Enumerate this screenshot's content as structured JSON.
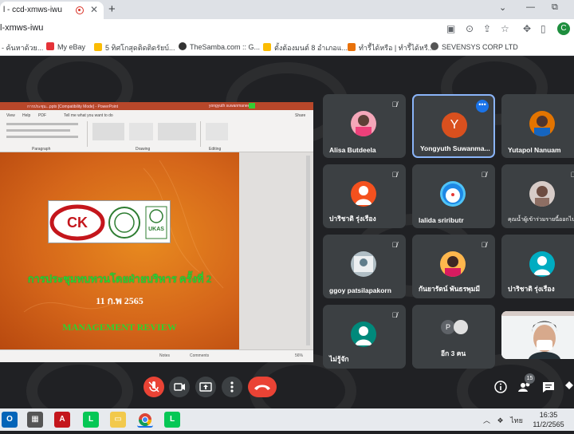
{
  "browser": {
    "tab_title": "l - ccd-xmws-iwu",
    "tab_close": "✕",
    "new_tab": "+",
    "url": "l-xmws-iwu",
    "profile_initial": "C",
    "window_min": "—",
    "window_restore": "⧉"
  },
  "bookmarks": [
    {
      "label": "- ค้นหาด้วย...",
      "color": "#4285f4"
    },
    {
      "label": "My eBay",
      "color": "#e53238"
    },
    {
      "label": "5 ทิศโกสุดติดติดรัยบ์...",
      "color": "#fbbc04"
    },
    {
      "label": "TheSamba.com :: G...",
      "color": "#333333"
    },
    {
      "label": "ตั้งต้องมนต์ 8 อำเภอแ...",
      "color": "#fbbc04"
    },
    {
      "label": "ทำรี้ได้หรือ | ทำรี้ได้หรื...",
      "color": "#e8710a"
    },
    {
      "label": "SEVENSYS CORP LTD",
      "color": "#555555"
    }
  ],
  "presentation": {
    "window_title": "การประชุม...pptx [Compatibility Mode] - PowerPoint",
    "user": "yongyuth suwanmanee",
    "ribbon_tabs": [
      "View",
      "Help",
      "PDF",
      "Tell me what you want to do",
      "Share"
    ],
    "ribbon_groups": [
      "Paragraph",
      "Drawing",
      "Editing"
    ],
    "slide_title": "การประชุมทบทวนโดยฝ่ายบริหาร ครั้งที่ 2",
    "slide_date": "11 ก.พ 2565",
    "slide_subtitle": "MANAGEMENT REVIEW",
    "logo_text": "CK",
    "cert_label": "UKAS",
    "status_notes": "Notes",
    "status_comments": "Comments",
    "zoom": "56%"
  },
  "participants": [
    {
      "name": "Alisa Butdeela",
      "avatar": "photo",
      "color": "#f4a7b9",
      "muted": true
    },
    {
      "name": "Yongyuth Suwanma...",
      "avatar": "Y",
      "color": "#d9501e",
      "muted": false,
      "active": true
    },
    {
      "name": "Yutapol Nanuam",
      "avatar": "photo",
      "color": "#e37400",
      "muted": false
    },
    {
      "name": "ปาริชาติ รุ่งเรือง",
      "avatar": "person",
      "color": "#f4511e",
      "muted": true
    },
    {
      "name": "lalida sriributr",
      "avatar": "photo",
      "color": "#4fc3f7",
      "muted": true
    },
    {
      "name": "คุณน้ำผู้เข้าร่วมรายนี้ออกไป",
      "avatar": "photo",
      "color": "#d7ccc8",
      "muted": true
    },
    {
      "name": "ggoy patsilapakorn",
      "avatar": "photo",
      "color": "#b0bec5",
      "muted": true
    },
    {
      "name": "กันยารัตน์ พันธรพุมมี",
      "avatar": "photo",
      "color": "#ffb74d",
      "muted": true
    },
    {
      "name": "ปาริชาติ รุ่งเรือง",
      "avatar": "person",
      "color": "#00acc1",
      "muted": false
    },
    {
      "name": "ไม่รู้จัก",
      "avatar": "person",
      "color": "#00897b",
      "muted": true
    },
    {
      "name": "อีก 3 คน",
      "avatar": "P",
      "color": "#5f6368",
      "muted": false
    },
    {
      "name": "",
      "avatar": "video",
      "color": "#f1f3f4",
      "muted": false
    }
  ],
  "controls": {
    "participant_count": "15"
  },
  "taskbar": {
    "time": "16:35",
    "date": "11/2/2565",
    "language": "ไทย"
  }
}
